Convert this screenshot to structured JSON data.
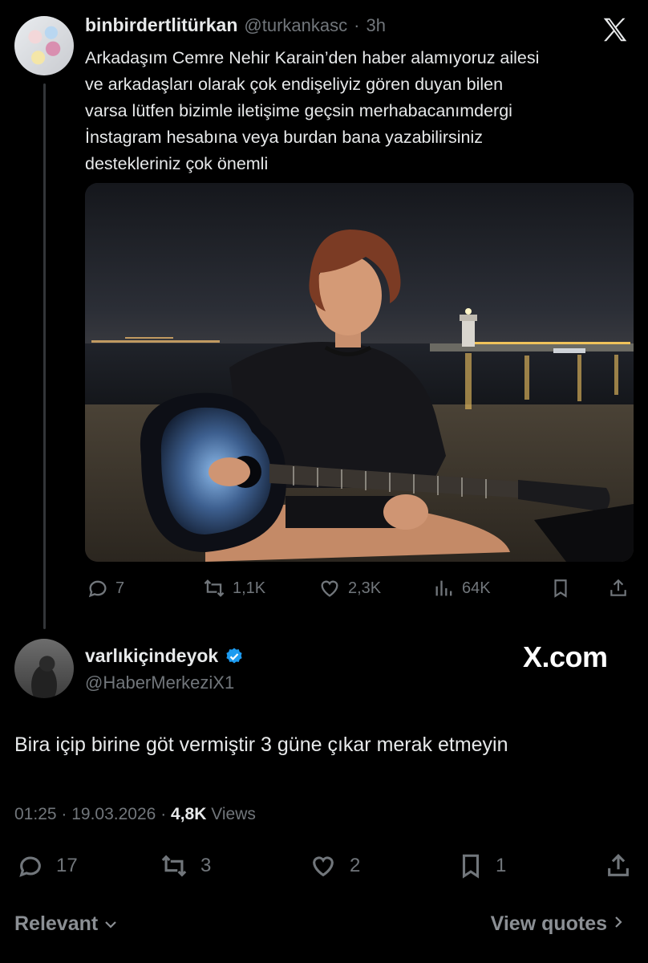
{
  "tweet": {
    "display_name": "binbirdertlitürkan",
    "handle": "@turkankasc",
    "separator": "·",
    "time": "3h",
    "text": "Arkadaşım Cemre Nehir Karain’den haber alamıyoruz ailesi\nve arkadaşları olarak çok endişeliyiz gören duyan bilen\nvarsa lütfen bizimle iletişime geçsin merhabacanımdergi\nİnstagram hesabına veya burdan bana yazabilirsiniz\ndestekleriniz çok önemli",
    "actions": {
      "replies": "7",
      "reposts": "1,1K",
      "likes": "2,3K",
      "views": "64K"
    }
  },
  "reply": {
    "display_name": "varlıkiçindeyok",
    "handle": "@HaberMerkeziX1",
    "verified": true,
    "text": "Bira içip birine göt vermiştir 3 güne çıkar merak etmeyin",
    "time": "01:25",
    "date": "19.03.2026",
    "views_count": "4,8K",
    "views_label": "Views",
    "actions": {
      "replies": "17",
      "reposts": "3",
      "likes": "2",
      "bookmarks": "1"
    }
  },
  "watermark": "X.com",
  "footer": {
    "sort_label": "Relevant",
    "quotes_label": "View quotes"
  },
  "colors": {
    "background": "#000000",
    "text": "#e7e9ea",
    "muted": "#71767b",
    "verified": "#1d9bf0"
  }
}
